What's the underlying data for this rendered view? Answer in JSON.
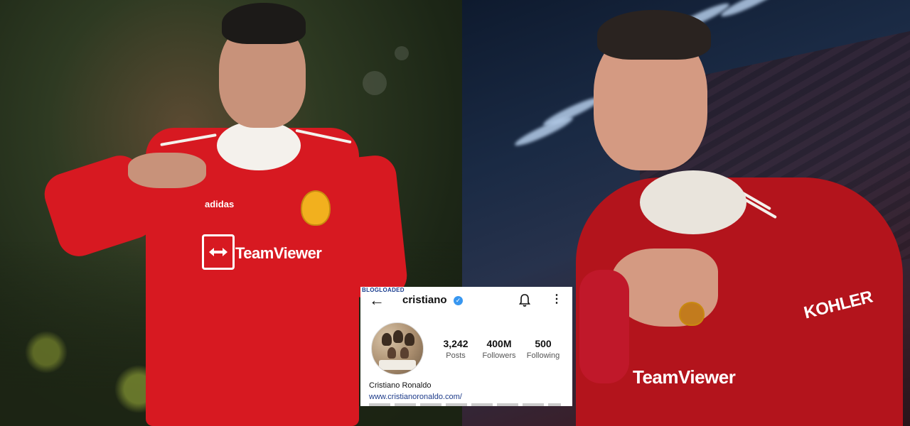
{
  "left_photo": {
    "sponsor": "TeamViewer",
    "kit_brand": "adidas"
  },
  "right_photo": {
    "sponsor": "TeamViewer",
    "sleeve_sponsor": "KOHLER"
  },
  "instagram_card": {
    "watermark": "BLOGLOADED",
    "username": "cristiano",
    "verified": true,
    "stats": [
      {
        "value": "3,242",
        "label": "Posts"
      },
      {
        "value": "400M",
        "label": "Followers"
      },
      {
        "value": "500",
        "label": "Following"
      }
    ],
    "display_name": "Cristiano Ronaldo",
    "website": "www.cristianoronaldo.com/"
  },
  "icons": {
    "back": "arrow-left-icon",
    "verified": "verified-badge-icon",
    "notifications": "bell-icon",
    "more": "more-vertical-icon"
  },
  "colors": {
    "kit_red": "#d71921",
    "verified_blue": "#3897f0",
    "link_blue": "#1d3b8a"
  }
}
